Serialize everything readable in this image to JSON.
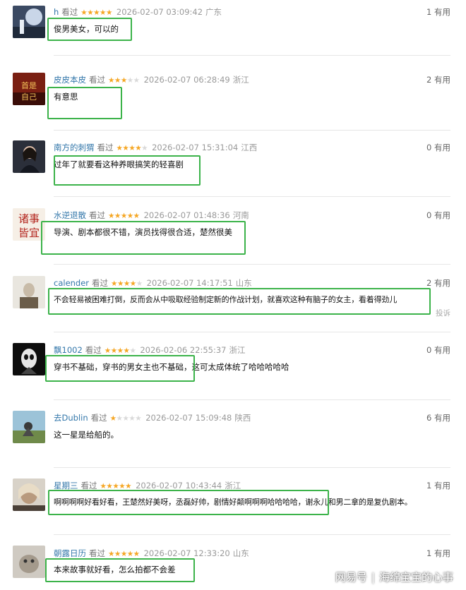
{
  "seen_label": "看过",
  "useful_suffix": "有用",
  "report_label": "投诉",
  "comments": [
    {
      "user": "h",
      "stars": 5,
      "date": "2026-02-07 03:09:42",
      "region": "广东",
      "useful": "1",
      "text": "俊男美女，可以的"
    },
    {
      "user": "皮皮本皮",
      "stars": 3,
      "date": "2026-02-07 06:28:49",
      "region": "浙江",
      "useful": "2",
      "text": "有意思"
    },
    {
      "user": "南方的刺猬",
      "stars": 4,
      "date": "2026-02-07 15:31:04",
      "region": "江西",
      "useful": "0",
      "text": "过年了就要看这种养眼搞笑的轻喜剧"
    },
    {
      "user": "水逆退散",
      "stars": 5,
      "date": "2026-02-07 01:48:36",
      "region": "河南",
      "useful": "0",
      "text": "导演、剧本都很不错，演员找得很合适，楚然很美"
    },
    {
      "user": "calender",
      "stars": 4,
      "date": "2026-02-07 14:17:51",
      "region": "山东",
      "useful": "2",
      "text": "不会轻易被困难打倒，反而会从中吸取经验制定新的作战计划，就喜欢这种有脑子的女主，看着得劲儿"
    },
    {
      "user": "飘1002",
      "stars": 4,
      "date": "2026-02-06 22:55:37",
      "region": "浙江",
      "useful": "0",
      "text": "穿书不基础，穿书的男女主也不基础，这可太成体统了哈哈哈哈哈"
    },
    {
      "user": "去Dublin",
      "stars": 1,
      "date": "2026-02-07 15:09:48",
      "region": "陕西",
      "useful": "6",
      "text": "这一星是给船的。"
    },
    {
      "user": "星期三",
      "stars": 5,
      "date": "2026-02-07 10:43:44",
      "region": "浙江",
      "useful": "1",
      "text": "啊啊啊啊好看好看，王楚然好美呀，丞磊好帅，剧情好颠啊啊啊哈哈哈哈，谢永儿和男二拿的是复仇剧本。"
    },
    {
      "user": "朝露日历",
      "stars": 5,
      "date": "2026-02-07 12:33:20",
      "region": "山东",
      "useful": "1",
      "text": "本来故事就好看，怎么拍都不会差"
    }
  ],
  "watermark": {
    "platform": "网易号",
    "account": "海绵宝宝的心事"
  },
  "colors": {
    "highlight": "#3cb34a",
    "username": "#3377aa",
    "star": "#f5a623"
  }
}
